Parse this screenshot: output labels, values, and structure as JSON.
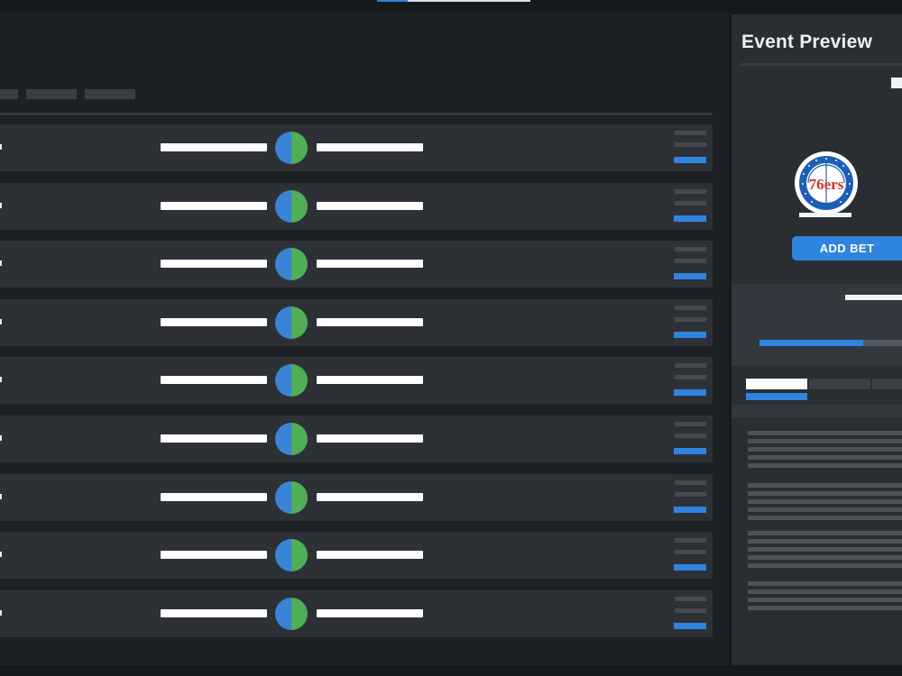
{
  "colors": {
    "background": "#16191c",
    "panel": "#1d2125",
    "row": "#2d3136",
    "accent_blue": "#2f84e0",
    "accent_green": "#4fae57",
    "text_primary": "#eef0f2"
  },
  "filters": {
    "count": 3
  },
  "events": {
    "rows": 9,
    "icon": "home-away-split-circle-icon"
  },
  "preview": {
    "title": "Event Preview",
    "team_logo_icon": "philadelphia-76ers-logo-icon",
    "add_bet_label": "ADD BET",
    "odds_progress": 0.73
  }
}
